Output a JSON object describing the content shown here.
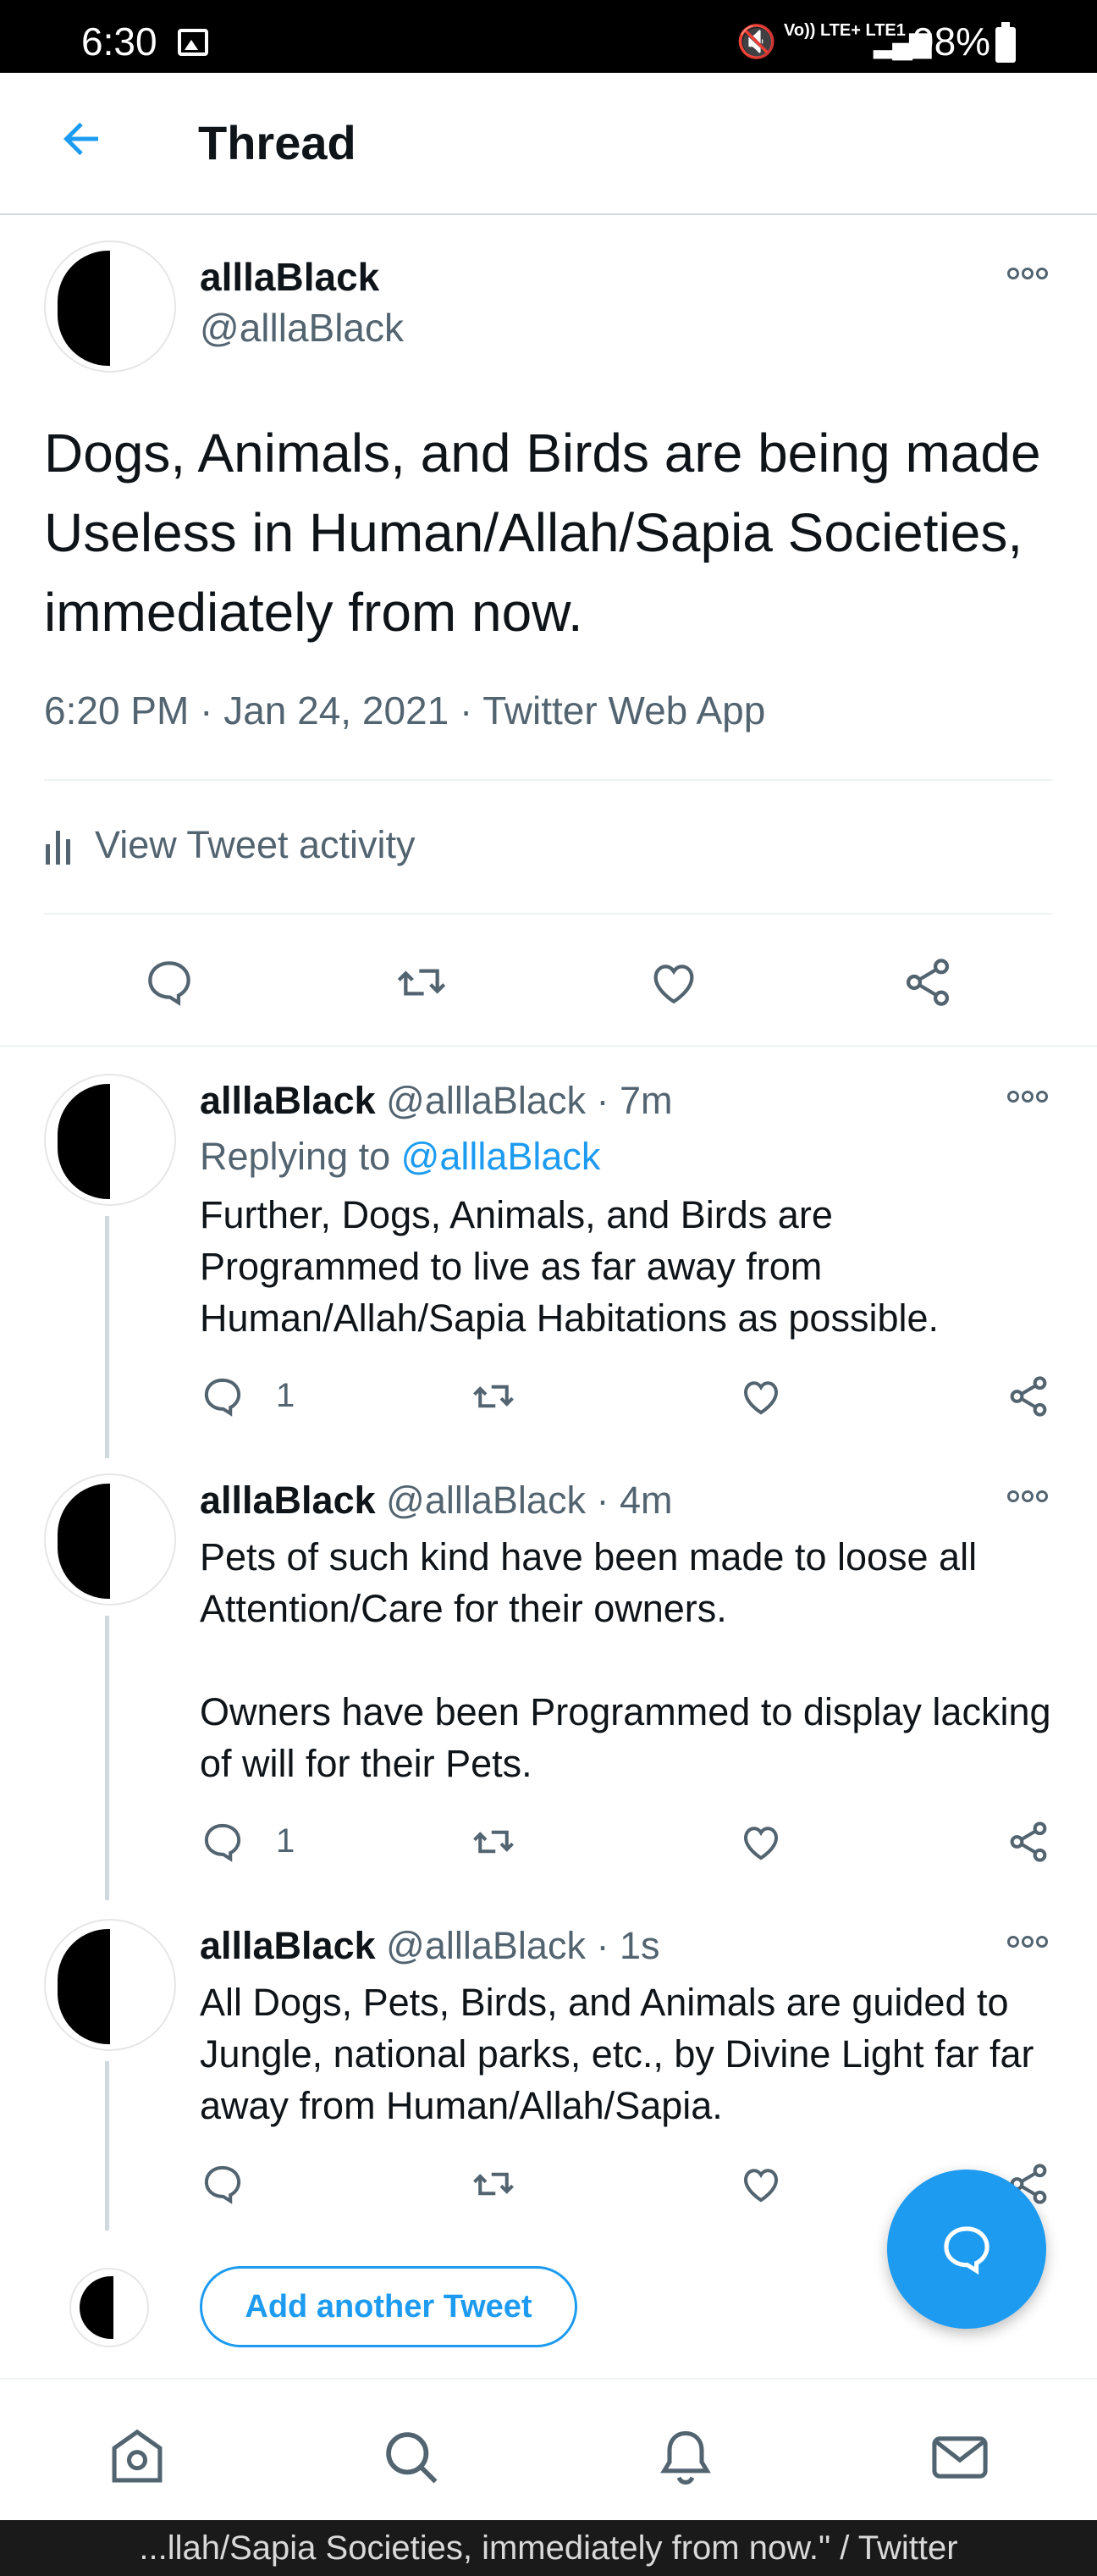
{
  "status_bar": {
    "time": "6:30",
    "network": "Vo)) LTE+ LTE1",
    "battery": "98%"
  },
  "header": {
    "title": "Thread"
  },
  "main_tweet": {
    "name": "alllaBlack",
    "handle": "@alllaBlack",
    "text": "Dogs, Animals, and Birds are being made Useless in Human/Allah/Sapia Societies, immediately from now.",
    "meta": "6:20 PM · Jan 24, 2021 · Twitter Web App",
    "activity_label": "View Tweet activity"
  },
  "replies": [
    {
      "name": "alllaBlack",
      "handle": "@alllaBlack",
      "time": "· 7m",
      "replying_prefix": "Replying to ",
      "replying_handle": "@alllaBlack",
      "text": "Further, Dogs, Animals, and Birds are Programmed to live as far away from Human/Allah/Sapia Habitations as possible.",
      "reply_count": "1"
    },
    {
      "name": "alllaBlack",
      "handle": "@alllaBlack",
      "time": "· 4m",
      "text": "Pets of such kind have been made to loose all Attention/Care for their owners.\n\nOwners have been Programmed to display lacking of will for their Pets.",
      "reply_count": "1"
    },
    {
      "name": "alllaBlack",
      "handle": "@alllaBlack",
      "time": "· 1s",
      "text": "All Dogs, Pets, Birds, and Animals are guided to Jungle, national parks, etc., by Divine Light far far away from Human/Allah/Sapia.",
      "reply_count": ""
    }
  ],
  "compose": {
    "add_tweet_label": "Add another Tweet"
  },
  "bottom_nav": [
    "home-icon",
    "search-icon",
    "notifications-icon",
    "messages-icon"
  ],
  "system_bar": {
    "text": "...llah/Sapia Societies, immediately from now.\" / Twitter"
  },
  "colors": {
    "accent": "#1d9bf0",
    "secondary_text": "#536471",
    "divider": "#eff3f4"
  }
}
